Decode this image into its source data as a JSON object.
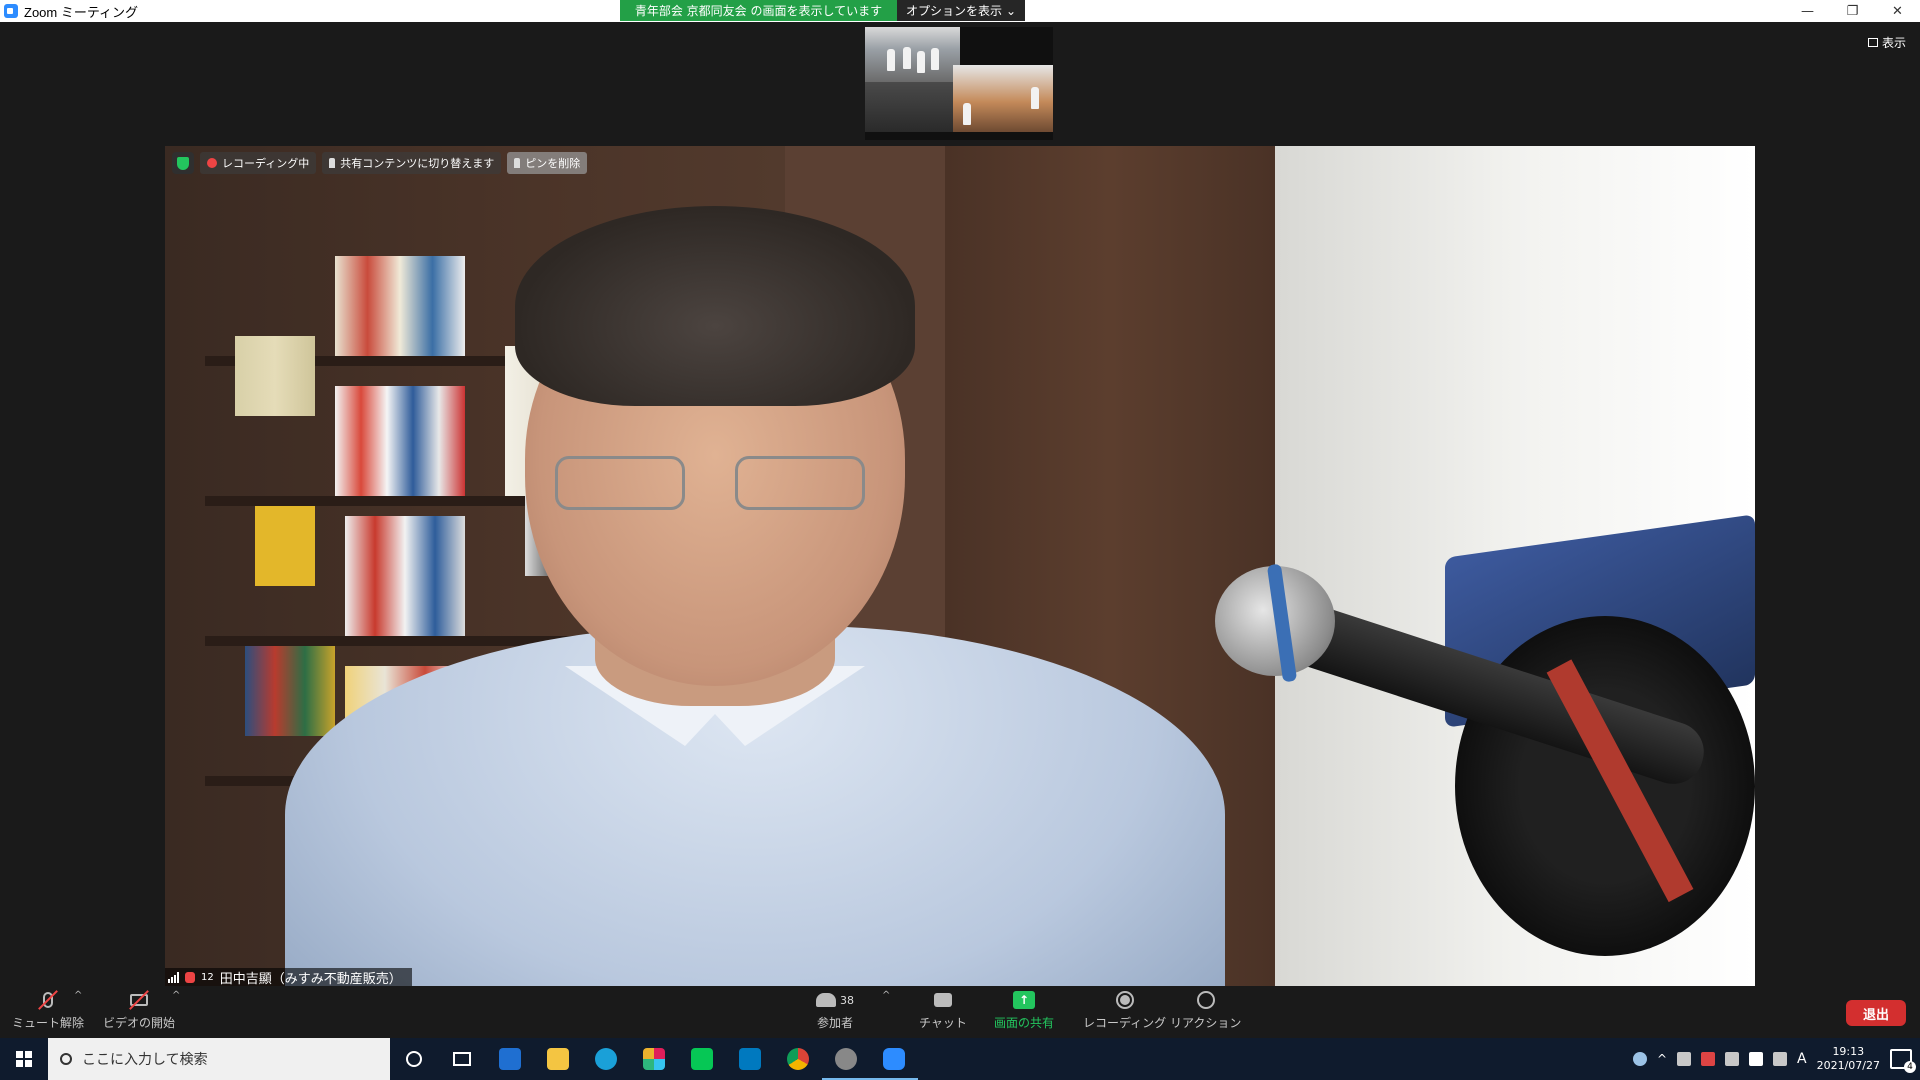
{
  "window": {
    "title": "Zoom ミーティング",
    "controls": {
      "minimize": "—",
      "restore": "❐",
      "close": "✕"
    }
  },
  "share_banner": {
    "text": "青年部会 京都同友会 の画面を表示しています",
    "options_label": "オプションを表示",
    "options_caret": "⌄"
  },
  "view_button": {
    "label": "表示"
  },
  "video_overlay": {
    "recording_label": "レコーディング中",
    "switch_label": "共有コンテンツに切り替えます",
    "unpin_label": "ピンを削除"
  },
  "name_tag": {
    "number": "12",
    "name": "田中吉顯（みすみ不動産販売）"
  },
  "toolbar": {
    "unmute_label": "ミュート解除",
    "start_video_label": "ビデオの開始",
    "participants_label": "参加者",
    "participants_count": "38",
    "chat_label": "チャット",
    "share_label": "画面の共有",
    "record_label": "レコーディング",
    "reaction_label": "リアクション",
    "leave_label": "退出",
    "caret": "^",
    "share_arrow": "↑"
  },
  "taskbar": {
    "search_placeholder": "ここに入力して検索",
    "time": "19:13",
    "date": "2021/07/27",
    "ime": "A",
    "notifications": "4"
  },
  "colors": {
    "share_green": "#23a047",
    "leave_red": "#d32f2f",
    "taskbar_bg": "#0f1b2d"
  }
}
